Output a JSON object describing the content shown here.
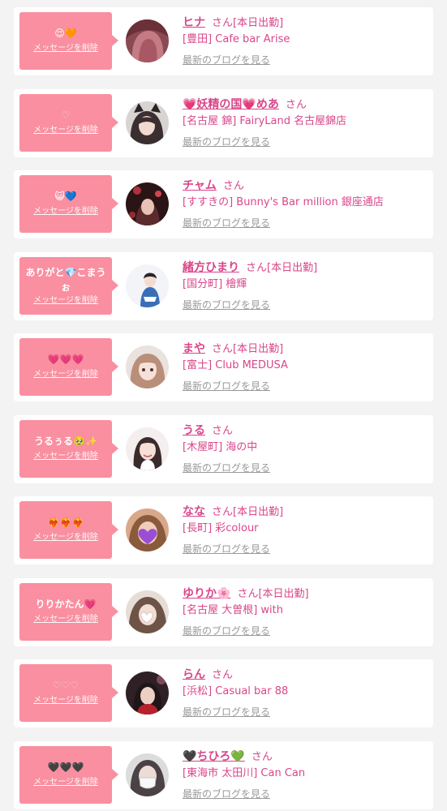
{
  "delete_label": "メッセージを削除",
  "blog_label": "最新のブログを見る",
  "san_label": "さん",
  "colors": {
    "accent": "#d9468a",
    "bubble": "#f98fa0",
    "muted": "#9a9a9a",
    "background": "#f3f3f3"
  },
  "items": [
    {
      "message": "😌🧡",
      "name": "ヒナ",
      "duty": "[本日出勤]",
      "shop": "[豊田] Cafe bar Arise",
      "avatar": "hair-photo"
    },
    {
      "message": "♡",
      "name": "💗妖精の国💗めあ",
      "duty": "",
      "shop": "[名古屋 錦] FairyLand 名古屋錦店",
      "avatar": "cat-ears-photo"
    },
    {
      "message": "😺💙",
      "name": "チャム",
      "duty": "",
      "shop": "[すすきの] Bunny's Bar million 銀座通店",
      "avatar": "dark-room-photo"
    },
    {
      "message": "ありがと💎こまうぉ",
      "name": "緒方ひまり",
      "duty": "[本日出勤]",
      "shop": "[国分町] 檜輝",
      "avatar": "blue-outfit-photo"
    },
    {
      "message": "💗💗💗",
      "name": "まや",
      "duty": "[本日出勤]",
      "shop": "[富士] Club MEDUSA",
      "avatar": "selfie-photo"
    },
    {
      "message": "うるぅる🥹✨",
      "name": "うる",
      "duty": "",
      "shop": "[木屋町] 海の中",
      "avatar": "smiling-photo"
    },
    {
      "message": "❤️‍🔥❤️‍🔥❤️‍🔥",
      "name": "なな",
      "duty": "[本日出勤]",
      "shop": "[長町] 彩colour",
      "avatar": "purple-heart-photo"
    },
    {
      "message": "りりかたん💗",
      "name": "ゆりか🌸",
      "duty": "[本日出勤]",
      "shop": "[名古屋 大曽根] with",
      "avatar": "hand-heart-photo"
    },
    {
      "message": "♡♡♡",
      "name": "らん",
      "duty": "",
      "shop": "[浜松] Casual bar 88",
      "avatar": "red-dress-photo"
    },
    {
      "message": "🖤🖤🖤",
      "name": "🖤ちひろ💚",
      "duty": "",
      "shop": "[東海市 太田川] Can Can",
      "avatar": "mask-selfie-photo"
    }
  ]
}
